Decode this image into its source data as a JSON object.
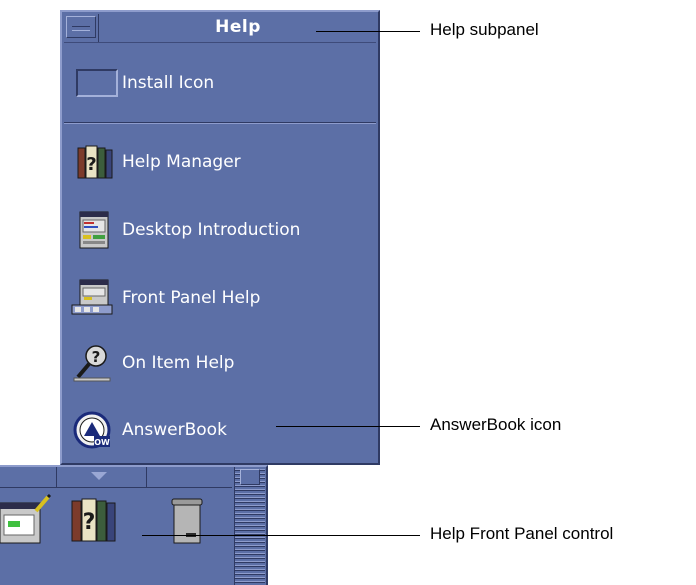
{
  "subpanel": {
    "title": "Help",
    "items": [
      {
        "label": "Install Icon",
        "icon": "install-icon"
      },
      {
        "label": "Help Manager",
        "icon": "books-question-icon"
      },
      {
        "label": "Desktop Introduction",
        "icon": "desktop-intro-icon"
      },
      {
        "label": "Front Panel Help",
        "icon": "front-panel-help-icon"
      },
      {
        "label": "On Item Help",
        "icon": "magnifier-question-icon"
      },
      {
        "label": "AnswerBook",
        "icon": "answerbook-icon"
      }
    ]
  },
  "front_panel": {
    "controls": [
      {
        "icon": "text-editor-icon"
      },
      {
        "icon": "help-books-icon"
      },
      {
        "icon": "trash-can-icon"
      }
    ]
  },
  "callouts": {
    "help_subpanel": "Help subpanel",
    "answerbook_icon": "AnswerBook icon",
    "help_front_panel_control": "Help Front Panel control"
  },
  "colors": {
    "panel_background": "#5c6fa6",
    "panel_text": "#ffffff",
    "page_background": "#ffffff"
  }
}
